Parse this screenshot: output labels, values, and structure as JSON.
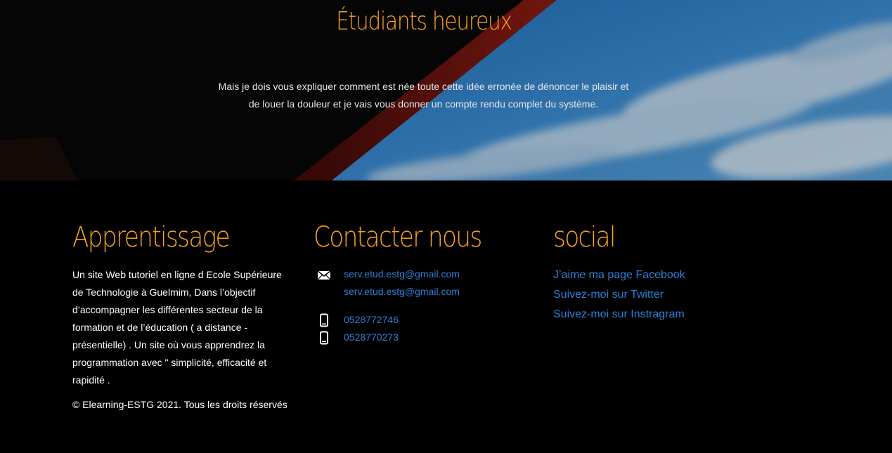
{
  "hero": {
    "title": "Étudiants heureux",
    "text_line1": "Mais je dois vous expliquer comment est née toute cette idée erronée de dénoncer le plaisir et",
    "text_line2": "de louer la douleur et je vais vous donner un compte rendu complet du système."
  },
  "footer": {
    "about": {
      "heading": "Apprentissage",
      "lines": [
        "Un site Web tutoriel en ligne d Ecole Supérieure",
        "de Technologie à Guelmim, Dans l’objectif",
        "d’accompagner les différentes secteur de la",
        "formation et de l’éducation ( a distance -",
        "présentielle) . Un site où vous apprendrez la",
        "programmation avec \" simplicité, efficacité et",
        "rapidité ."
      ],
      "copyright": "© Elearning-ESTG 2021. Tous les droits réservés"
    },
    "contact": {
      "heading": "Contacter nous",
      "emails": [
        "serv.etud.estg@gmail.com",
        "serv.etud.estg@gmail.com"
      ],
      "phones": [
        "0528772746",
        "0528770273"
      ],
      "email_icon": "envelope-icon",
      "phone_icon": "mobile-phone-icon"
    },
    "social": {
      "heading": "social",
      "links": [
        "J’aime ma page Facebook",
        "Suivez-moi sur Twitter",
        "Suivez-moi sur Instragram"
      ]
    }
  },
  "colors": {
    "accent": "#f7a21b",
    "link": "#2f7fd6",
    "background": "#000000",
    "text": "#ffffff"
  }
}
